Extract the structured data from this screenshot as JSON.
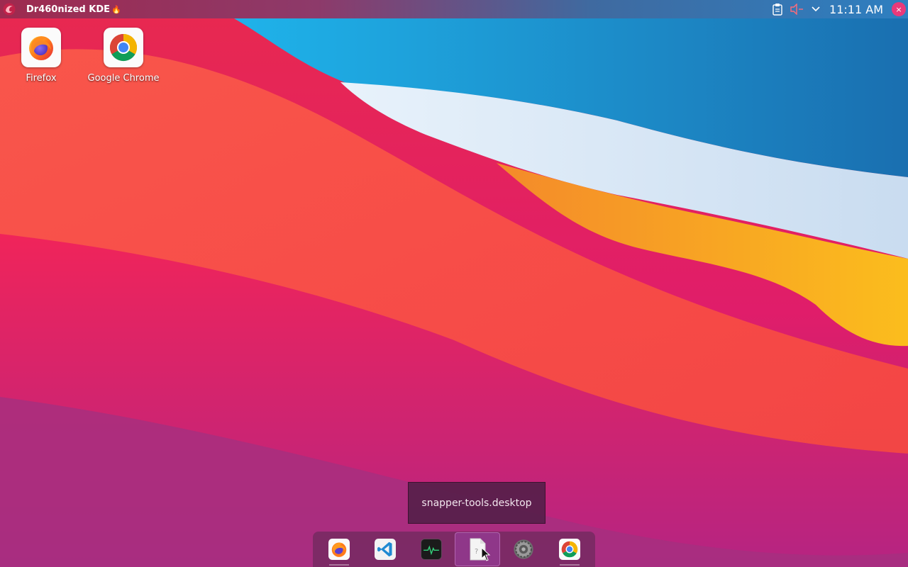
{
  "panel": {
    "title": "Dr460nized KDE",
    "title_emoji": "🔥",
    "clock": "11:11 AM",
    "close_glyph": "×",
    "icons": [
      "dragon-launcher-icon",
      "clipboard-icon",
      "volume-muted-icon",
      "chevron-down-icon"
    ]
  },
  "desktop": {
    "icons": [
      {
        "label": "Firefox",
        "icon": "firefox-icon"
      },
      {
        "label": "Google Chrome",
        "icon": "chrome-icon"
      }
    ]
  },
  "tooltip": {
    "text": "snapper-tools.desktop"
  },
  "dock": {
    "items": [
      {
        "name": "firefox",
        "icon": "firefox-icon"
      },
      {
        "name": "vscode",
        "icon": "vscode-icon"
      },
      {
        "name": "system-monitor",
        "icon": "system-monitor-icon"
      },
      {
        "name": "snapper-tools",
        "icon": "file-icon",
        "active": true
      },
      {
        "name": "system-settings",
        "icon": "settings-icon"
      },
      {
        "name": "google-chrome",
        "icon": "chrome-icon"
      }
    ]
  },
  "colors": {
    "accent": "#e9397a",
    "panel_left": "#9e2a4f",
    "panel_right": "#2e7fc0"
  }
}
